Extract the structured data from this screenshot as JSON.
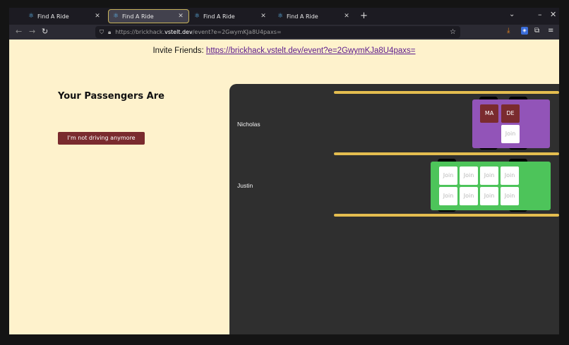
{
  "browser": {
    "tabs": [
      {
        "label": "Find A Ride",
        "active": false
      },
      {
        "label": "Find A Ride",
        "active": true
      },
      {
        "label": "Find A Ride",
        "active": false
      },
      {
        "label": "Find A Ride",
        "active": false
      }
    ],
    "url": {
      "prefix": "https://brickhack.",
      "host": "vstelt.dev",
      "path": "/event?e=2GwymKJa8U4paxs="
    }
  },
  "page": {
    "invite_label": "Invite Friends:",
    "invite_link": "https://brickhack.vstelt.dev/event?e=2GwymKJa8U4paxs=",
    "passengers_title": "Your Passengers Are",
    "stop_driving_label": "I'm not driving anymore",
    "cars": [
      {
        "driver": "Nicholas",
        "color": "#9254b8",
        "seats": [
          {
            "text": "MA",
            "taken": true
          },
          {
            "text": "DE",
            "taken": true
          },
          {
            "text": "",
            "taken": false,
            "hidden": true
          },
          {
            "text": "Join",
            "taken": false
          }
        ]
      },
      {
        "driver": "Justin",
        "color": "#4dc45a",
        "seats": [
          {
            "text": "Join",
            "taken": false
          },
          {
            "text": "Join",
            "taken": false
          },
          {
            "text": "Join",
            "taken": false
          },
          {
            "text": "Join",
            "taken": false
          },
          {
            "text": "Join",
            "taken": false
          },
          {
            "text": "Join",
            "taken": false
          },
          {
            "text": "Join",
            "taken": false
          },
          {
            "text": "Join",
            "taken": false
          }
        ]
      }
    ]
  }
}
